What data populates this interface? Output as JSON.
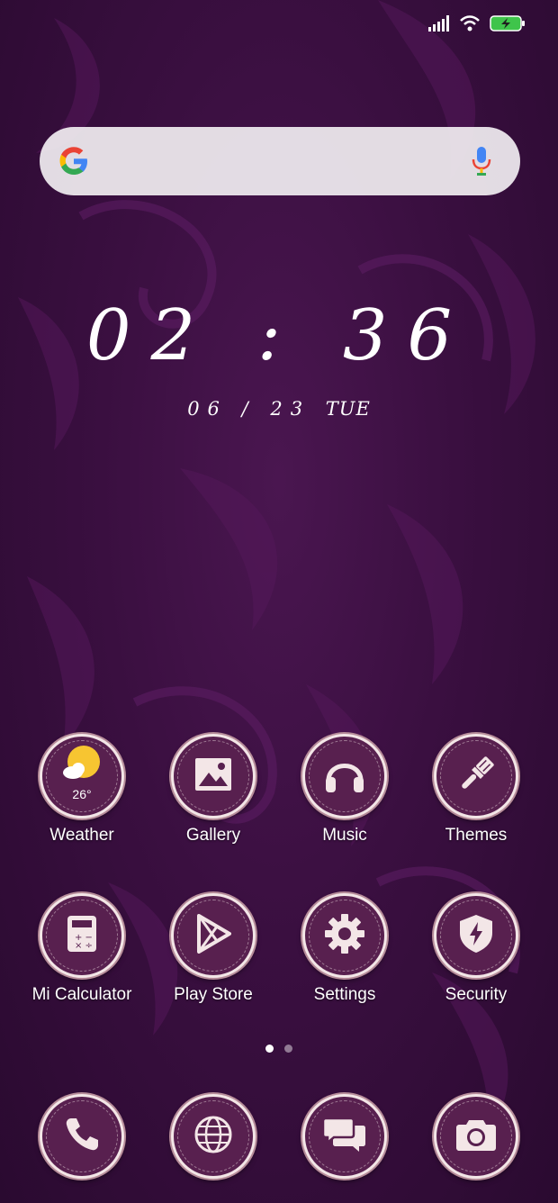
{
  "status_bar": {
    "icons": [
      "signal-icon",
      "wifi-icon",
      "battery-charging-icon"
    ],
    "battery_color": "#3fc44b"
  },
  "search_bar": {
    "icons": [
      "google-logo-icon",
      "microphone-icon"
    ]
  },
  "clock": {
    "time": "02 : 36",
    "date": "06 / 23",
    "day": "TUE"
  },
  "apps": {
    "weather": {
      "label": "Weather",
      "temp": "26°",
      "icon": "sun-cloud-icon"
    },
    "gallery": {
      "label": "Gallery",
      "icon": "image-icon"
    },
    "music": {
      "label": "Music",
      "icon": "headphones-icon"
    },
    "themes": {
      "label": "Themes",
      "icon": "paintbrush-icon"
    },
    "calculator": {
      "label": "Mi Calculator",
      "icon": "calculator-icon"
    },
    "play_store": {
      "label": "Play Store",
      "icon": "play-triangle-icon"
    },
    "settings": {
      "label": "Settings",
      "icon": "gear-icon"
    },
    "security": {
      "label": "Security",
      "icon": "shield-bolt-icon"
    }
  },
  "dock": {
    "icons": [
      "phone-icon",
      "globe-icon",
      "messages-icon",
      "camera-icon"
    ]
  },
  "pager": {
    "pages": 2,
    "current": 1
  },
  "colors": {
    "wallpaper": "#3a0f40",
    "icon_fill": "#58204f",
    "icon_border": "#f3e6e7",
    "glyph": "#f3e6e7",
    "sun": "#f7c531"
  }
}
